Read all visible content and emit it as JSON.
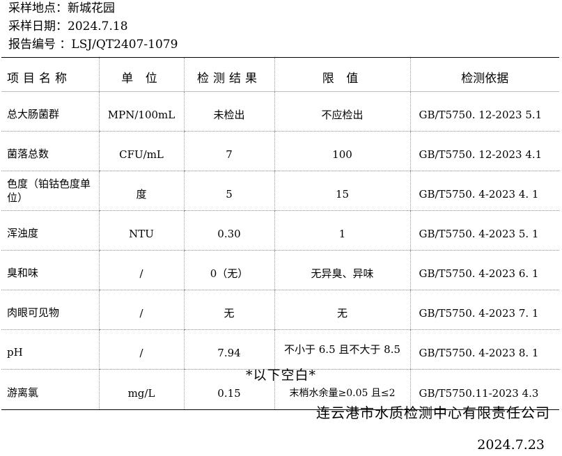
{
  "header": {
    "location": "采样地点：新城花园",
    "date": "采样日期：2024.7.18",
    "report_no": "报告编号 ：LSJ/QT2407-1079"
  },
  "table": {
    "columns": [
      "项目名称",
      "单 位",
      "检测结果",
      "限 值",
      "检测依据"
    ],
    "rows": [
      {
        "item": "总大肠菌群",
        "unit": "MPN/100mL",
        "result": "未检出",
        "limit": "不应检出",
        "basis": "GB/T5750. 12-2023    5.1"
      },
      {
        "item": "菌落总数",
        "unit": "CFU/mL",
        "result": "7",
        "limit": "100",
        "basis": "GB/T5750. 12-2023    4.1"
      },
      {
        "item": "色度（铂钴色度单位）",
        "unit": "度",
        "result": "5",
        "limit": "15",
        "basis": "GB/T5750. 4-2023    4. 1"
      },
      {
        "item": "浑浊度",
        "unit": "NTU",
        "result": "0.30",
        "limit": "1",
        "basis": "GB/T5750. 4-2023    5. 1"
      },
      {
        "item": "臭和味",
        "unit": "/",
        "result": "0（无）",
        "limit": "无异臭、异味",
        "basis": "GB/T5750. 4-2023    6. 1"
      },
      {
        "item": "肉眼可见物",
        "unit": "/",
        "result": "无",
        "limit": "无",
        "basis": "GB/T5750. 4-2023    7. 1"
      },
      {
        "item": "pH",
        "unit": "/",
        "result": "7.94",
        "limit": "不小于 6.5 且不大于 8.5",
        "basis": "GB/T5750. 4-2023    8. 1"
      },
      {
        "item": "游离氯",
        "unit": "mg/L",
        "result": "0.15",
        "limit": "末梢水余量≥0.05 且≤2",
        "basis": "GB/T5750.11-2023    4.3"
      }
    ]
  },
  "footer": {
    "blank_note": "*以下空白*",
    "company": "连云港市水质检测中心有限责任公司",
    "date": "2024.7.23"
  }
}
